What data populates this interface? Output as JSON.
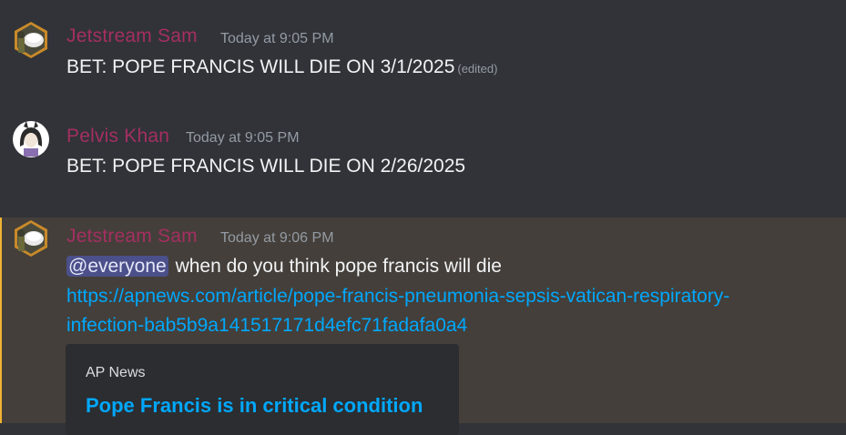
{
  "messages": [
    {
      "author": "Jetstream Sam",
      "timestamp": "Today at 9:05 PM",
      "text": "BET: POPE FRANCIS WILL DIE ON 3/1/2025",
      "edited": "(edited)",
      "avatar": "rice-bowl-character-avatar"
    },
    {
      "author": "Pelvis Khan",
      "timestamp": "Today at 9:05 PM",
      "text": "BET: POPE FRANCIS WILL DIE ON 2/26/2025",
      "avatar": "anime-girl-avatar"
    },
    {
      "author": "Jetstream Sam",
      "timestamp": "Today at 9:06 PM",
      "mention": "@everyone",
      "text": "when do you think pope francis will die",
      "link_line1": "https://apnews.com/article/pope-francis-pneumonia-sepsis-vatican-respiratory-",
      "link_line2": "infection-bab5b9a141517171d4efc71fadafa0a4",
      "avatar": "rice-bowl-character-avatar",
      "embed": {
        "provider": "AP News",
        "title": "Pope Francis is in critical condition"
      }
    }
  ],
  "colors": {
    "background": "#313338",
    "username": "#a42f61",
    "link": "#00a8fc",
    "mention_highlight": "#443f3a",
    "mention_bar": "#f0b232"
  }
}
